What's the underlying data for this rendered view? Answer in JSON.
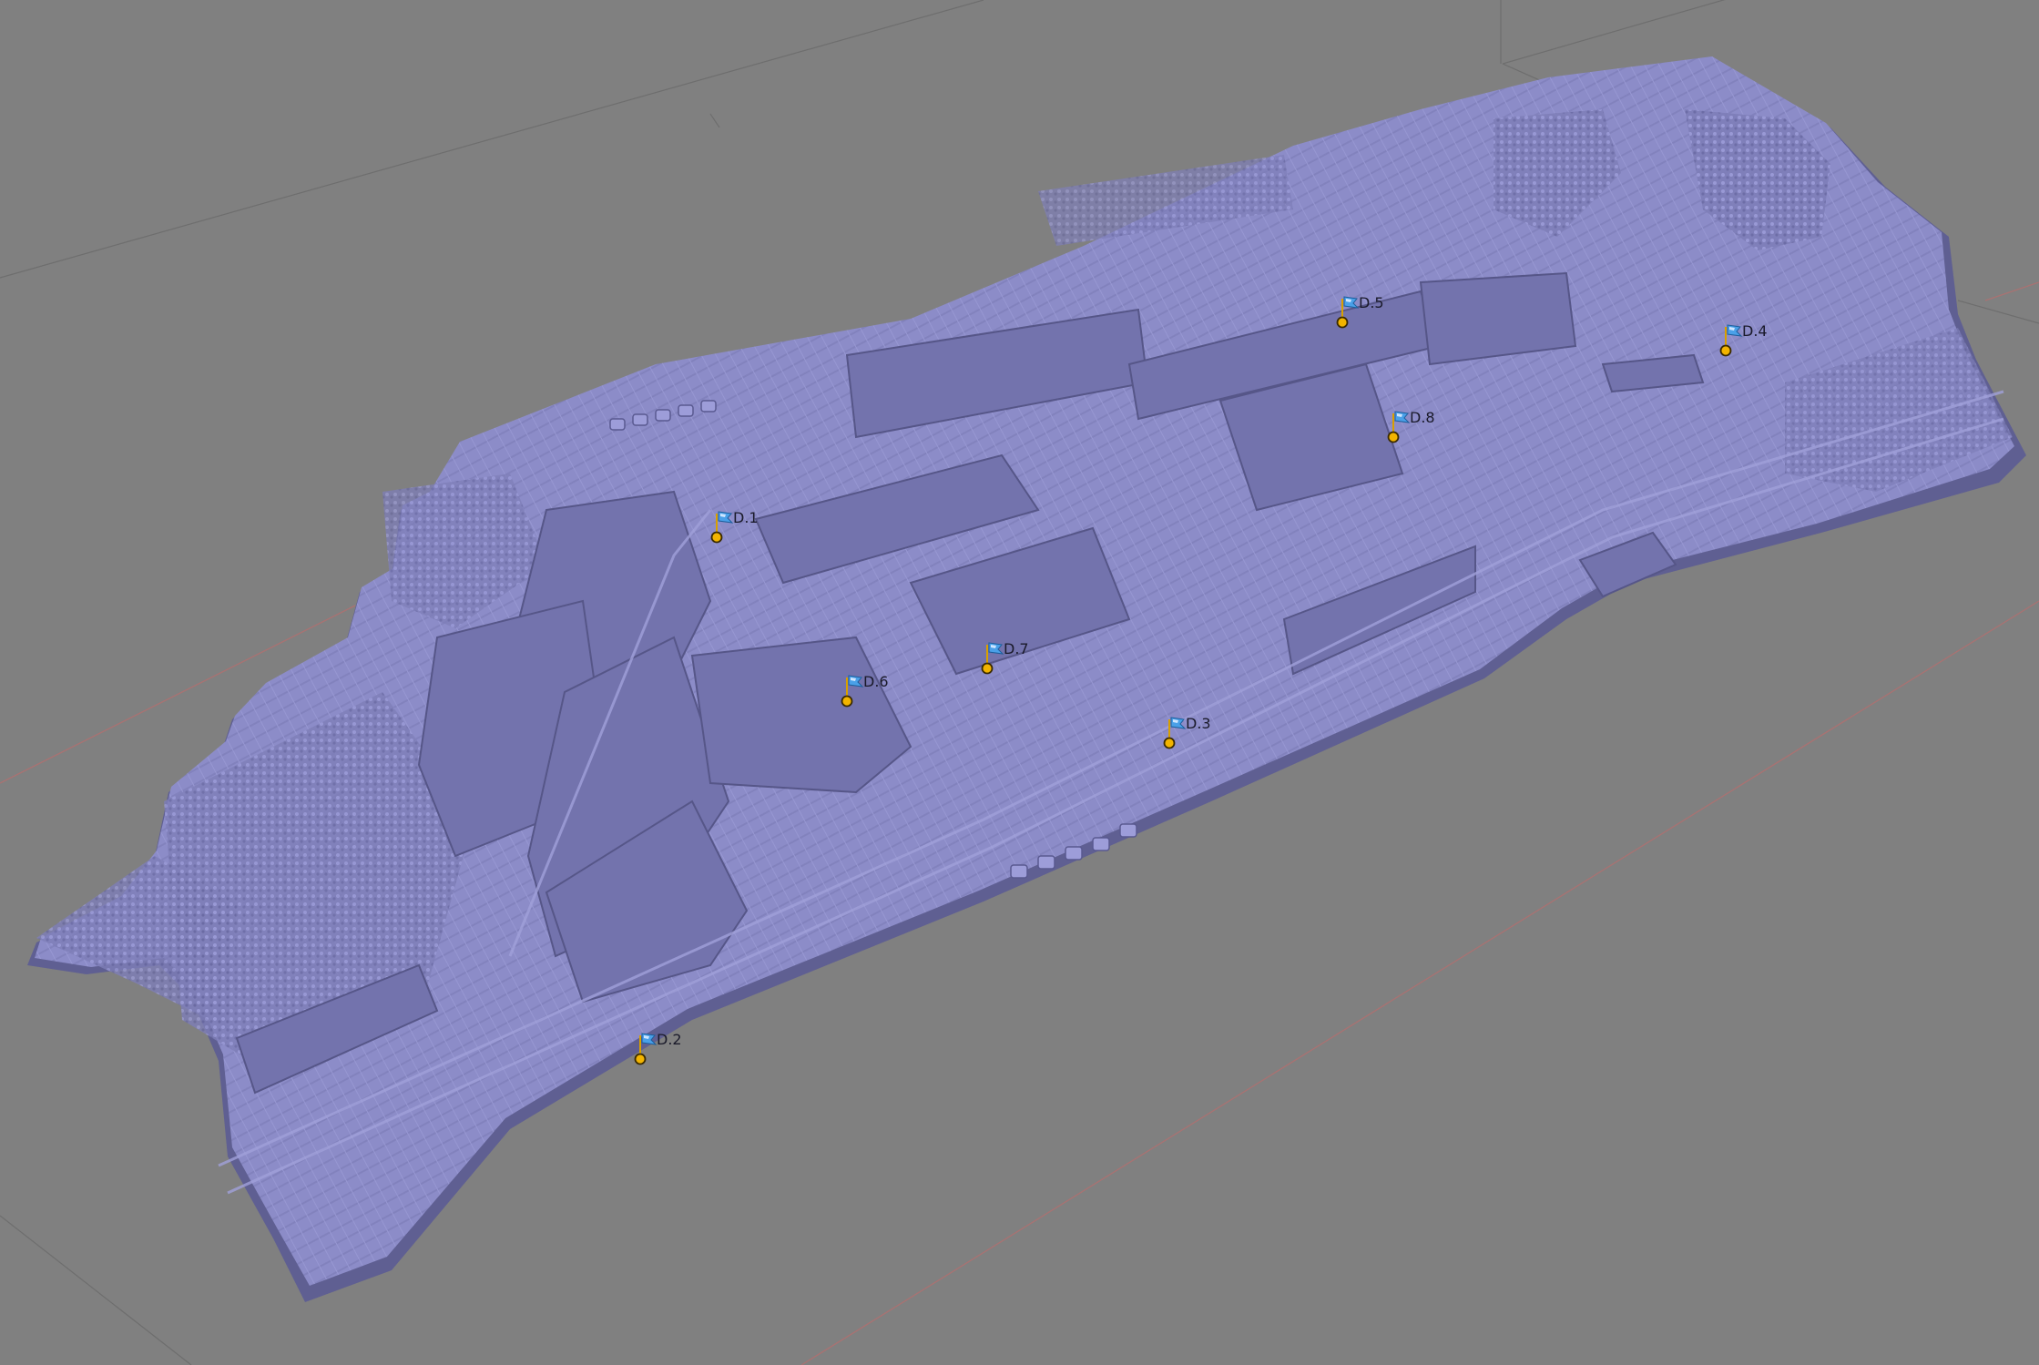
{
  "viewport": {
    "background_color": "#808080",
    "mesh_color": "#8c8cc8",
    "mesh_shadow_color": "#5f5f92",
    "grid_line_color": "#6e6e6e",
    "axis_x_color": "#b86a6a"
  },
  "markers": [
    {
      "id": "m1",
      "label": "D.1",
      "icon": "flag-icon"
    },
    {
      "id": "m2",
      "label": "D.2",
      "icon": "flag-icon"
    },
    {
      "id": "m3",
      "label": "D.3",
      "icon": "flag-icon"
    },
    {
      "id": "m4",
      "label": "D.4",
      "icon": "flag-icon"
    },
    {
      "id": "m5",
      "label": "D.5",
      "icon": "flag-icon"
    },
    {
      "id": "m6",
      "label": "D.6",
      "icon": "flag-icon"
    },
    {
      "id": "m7",
      "label": "D.7",
      "icon": "flag-icon"
    },
    {
      "id": "m8",
      "label": "D.8",
      "icon": "flag-icon"
    }
  ],
  "marker_style": {
    "point_fill": "#f2b400",
    "point_stroke": "#3a2a00",
    "flag_color": "#4aa0e8",
    "flag_highlight": "#cfe6ff"
  }
}
